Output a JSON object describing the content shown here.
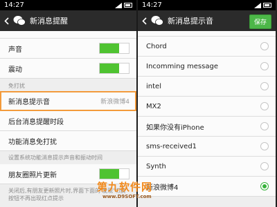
{
  "left": {
    "status_time": "14:27",
    "title": "新消息提醒",
    "rows": {
      "sound": "声音",
      "vibrate": "震动",
      "dnd_section": "免打扰",
      "tone_label": "新消息提示音",
      "tone_value": "新浪微博4",
      "bg_period": "后台消息提醒时段",
      "func_dnd": "功能消息免打扰",
      "func_hint": "设置系统功能消息提示声音和振动时间",
      "moments": "朋友圈照片更新",
      "moments_hint": "关闭后,有朋友更新照片时,界面下面的'发现'切换按钮不再出现红点提示"
    }
  },
  "right": {
    "status_time": "14:27",
    "title": "新消息提示音",
    "save_label": "保存",
    "tones": [
      {
        "label": "Chord",
        "selected": false
      },
      {
        "label": "Incomming message",
        "selected": false
      },
      {
        "label": "intel",
        "selected": false
      },
      {
        "label": "MX2",
        "selected": false
      },
      {
        "label": "如果你没有iPhone",
        "selected": false
      },
      {
        "label": "sms-received1",
        "selected": false
      },
      {
        "label": "Synth",
        "selected": false
      },
      {
        "label": "新浪微博4",
        "selected": true
      }
    ]
  },
  "watermark": {
    "main": "第九软件网",
    "url": "www.D9SOFT.com"
  },
  "colors": {
    "accent_green": "#4fc331",
    "highlight_orange": "#f39a3a",
    "titlebar": "#2b2b2b"
  }
}
